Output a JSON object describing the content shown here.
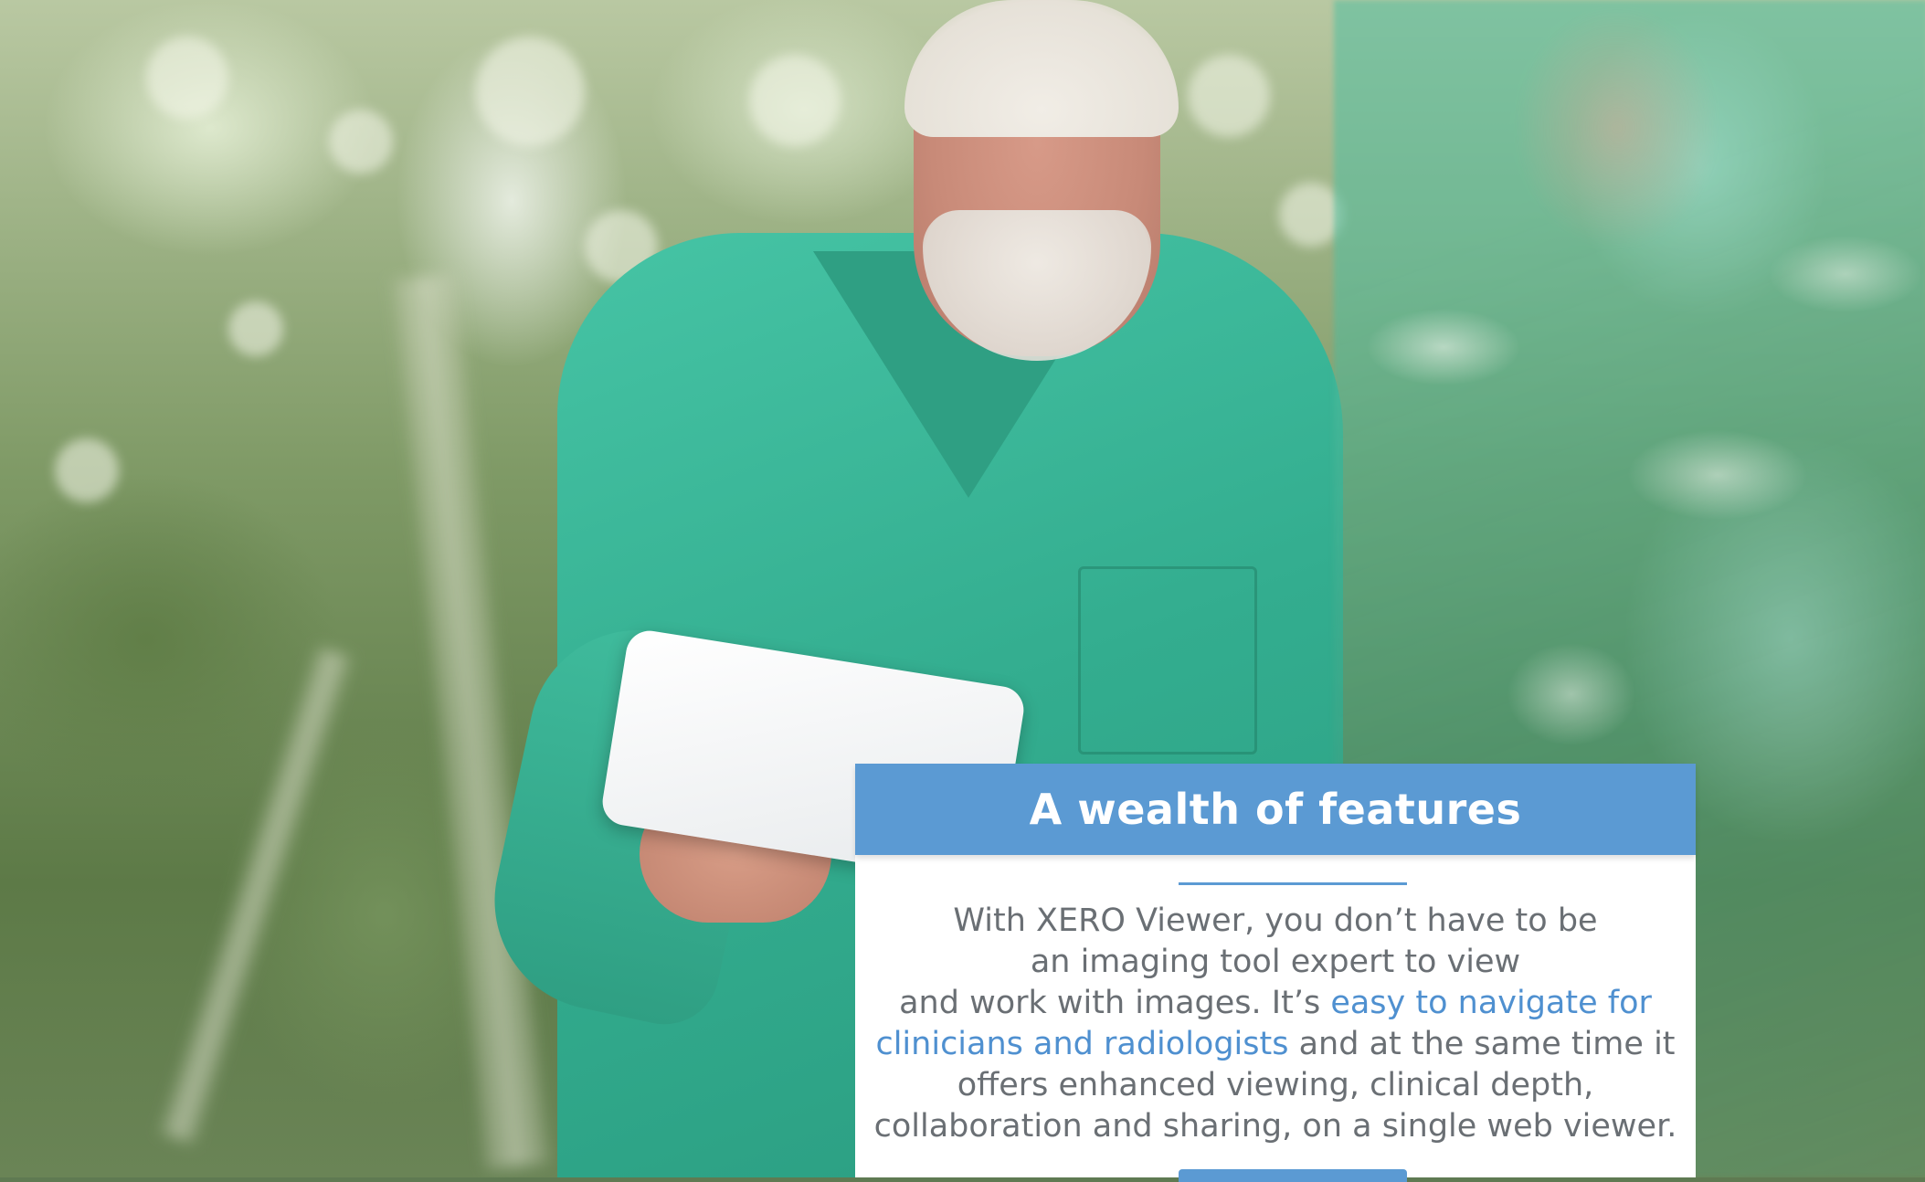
{
  "hero": {
    "description_icon": "photo-doctor-with-tablet"
  },
  "card": {
    "title": "A wealth of features",
    "body_line1": "With XERO Viewer, you don’t have to be",
    "body_line2": "an imaging tool expert to view",
    "body_line3_pre": "and work with images. It’s ",
    "body_link_part1": "easy to navigate for",
    "body_link_part2": "clinicians and radiologists",
    "body_line4_post": " and at the same time it",
    "body_line5": "offers enhanced viewing, clinical depth,",
    "body_line6": "collaboration and sharing, on a single web viewer.",
    "colors": {
      "header_bg": "#5b9ad3",
      "body_text": "#6a6f74",
      "highlight_text": "#4f90d0",
      "card_bg": "#ffffff"
    }
  }
}
